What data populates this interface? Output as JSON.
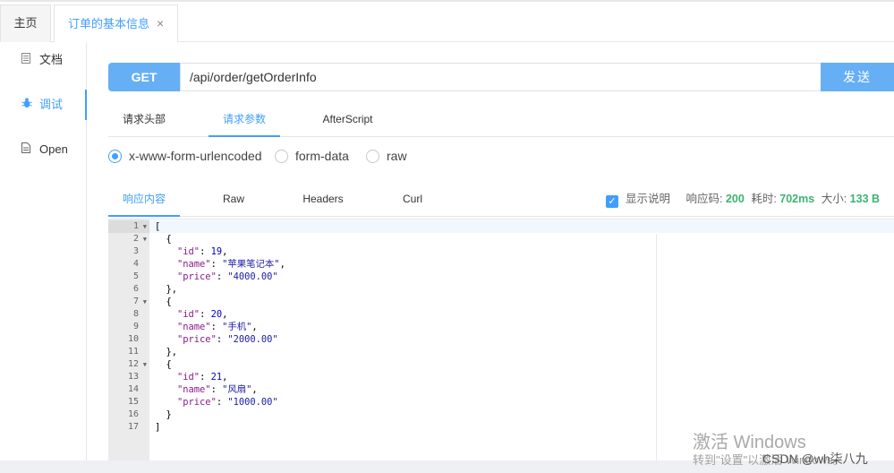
{
  "tabs": [
    {
      "label": "主页"
    },
    {
      "label": "订单的基本信息",
      "close": "×"
    }
  ],
  "sidebar": {
    "items": [
      {
        "label": "文档",
        "icon": "document-icon"
      },
      {
        "label": "调试",
        "icon": "bug-icon"
      },
      {
        "label": "Open",
        "icon": "file-icon"
      }
    ]
  },
  "request": {
    "method": "GET",
    "url": "/api/order/getOrderInfo",
    "send_label": "发送"
  },
  "request_tabs": [
    "请求头部",
    "请求参数",
    "AfterScript"
  ],
  "body_types": [
    "x-www-form-urlencoded",
    "form-data",
    "raw"
  ],
  "response_tabs": [
    "响应内容",
    "Raw",
    "Headers",
    "Curl"
  ],
  "response_meta": {
    "show_desc_label": "显示说明",
    "code_label": "响应码:",
    "code": "200",
    "time_label": "耗时:",
    "time": "702ms",
    "size_label": "大小:",
    "size": "133 B"
  },
  "code_lines": [
    "[",
    "  {",
    "    \"id\": 19,",
    "    \"name\": \"苹果笔记本\",",
    "    \"price\": \"4000.00\"",
    "  },",
    "  {",
    "    \"id\": 20,",
    "    \"name\": \"手机\",",
    "    \"price\": \"2000.00\"",
    "  },",
    "  {",
    "    \"id\": 21,",
    "    \"name\": \"风扇\",",
    "    \"price\": \"1000.00\"",
    "  }",
    "]"
  ],
  "fold_lines": [
    1,
    2,
    7,
    12
  ],
  "watermark": {
    "title": "激活 Windows",
    "subtitle": "转到\"设置\"以激活 Windows。",
    "csdn": "CSDN @wh柒八九"
  },
  "colors": {
    "accent": "#409eff",
    "button": "#66aff5",
    "success": "#3cb371"
  }
}
